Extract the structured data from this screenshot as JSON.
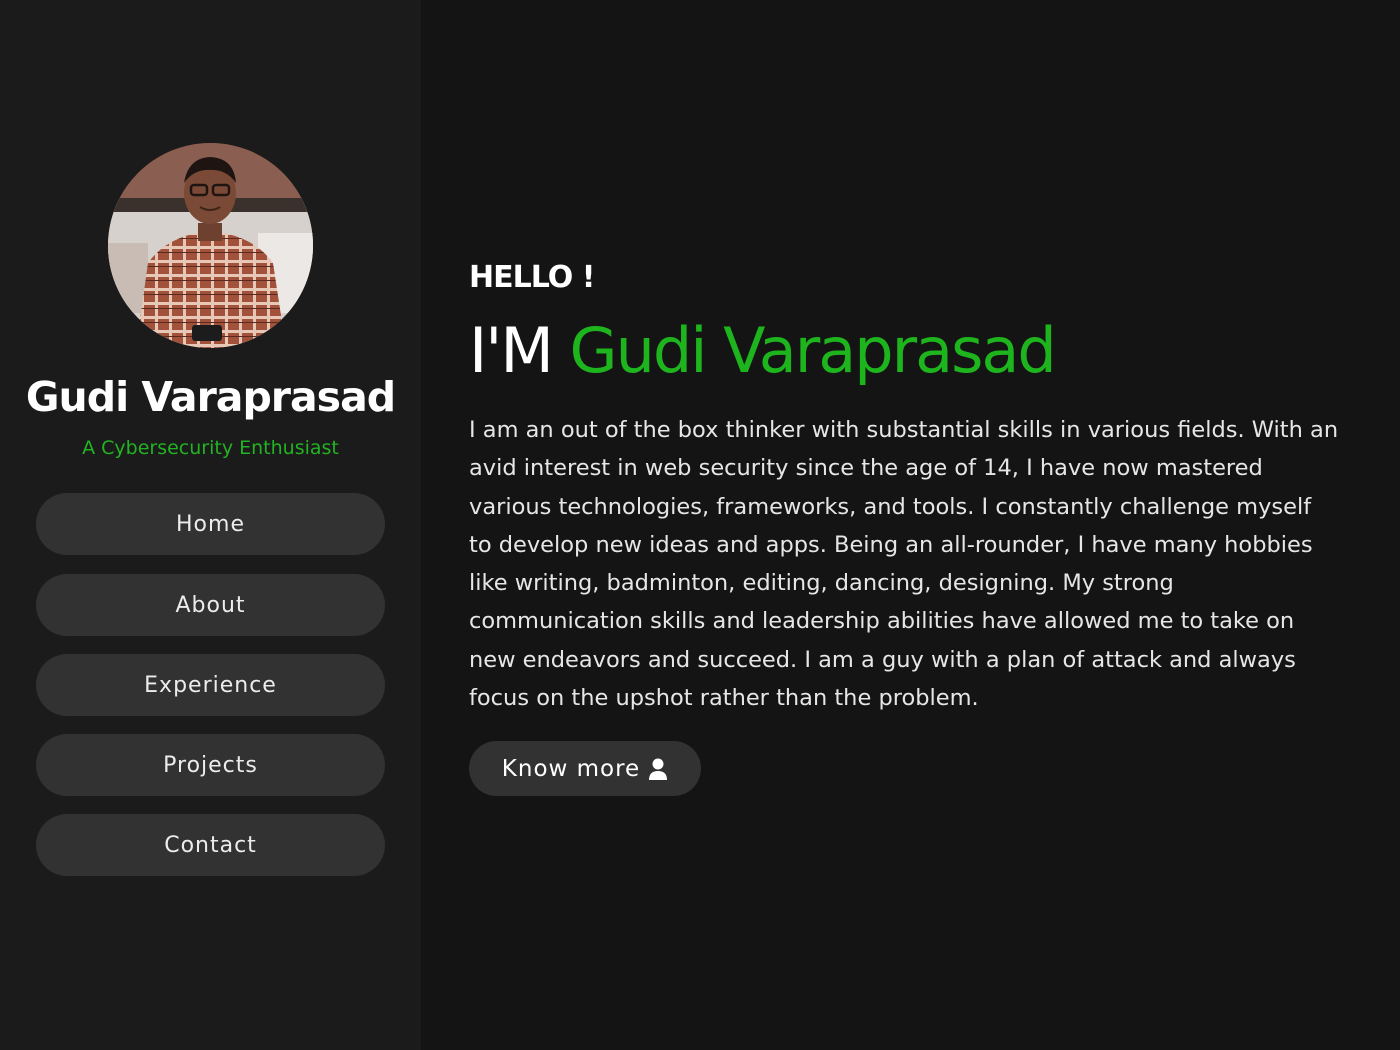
{
  "sidebar": {
    "name": "Gudi Varaprasad",
    "tagline": "A Cybersecurity Enthusiast",
    "nav": [
      {
        "label": "Home"
      },
      {
        "label": "About"
      },
      {
        "label": "Experience"
      },
      {
        "label": "Projects"
      },
      {
        "label": "Contact"
      }
    ]
  },
  "hero": {
    "greeting": "HELLO !",
    "prefix": "I'M",
    "name": "Gudi Varaprasad",
    "bio": "I am an out of the box thinker with substantial skills in various fields. With an avid interest in web security since the age of 14, I have now mastered various technologies, frameworks, and tools. I constantly challenge myself to develop new ideas and apps. Being an all-rounder, I have many hobbies like writing, badminton, editing, dancing, designing. My strong communication skills and leadership abilities have allowed me to take on new endeavors and succeed. I am a guy with a plan of attack and always focus on the upshot rather than the problem.",
    "cta": {
      "label": "Know more",
      "icon": "user-icon"
    }
  },
  "colors": {
    "accent": "#1db41d",
    "background": "#141414",
    "sidebar": "#1b1b1b",
    "button": "#323232"
  }
}
